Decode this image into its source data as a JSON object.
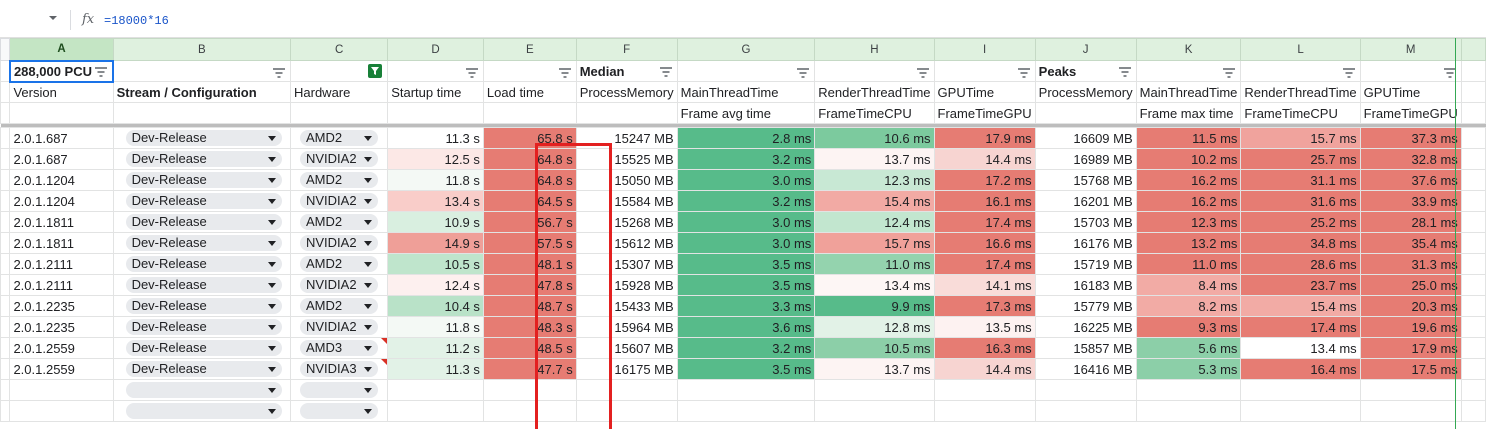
{
  "formula_bar": {
    "value": "=18000*16",
    "fx_label": "fx"
  },
  "columns": [
    {
      "letter": "A",
      "selected": true
    },
    {
      "letter": "B"
    },
    {
      "letter": "C"
    },
    {
      "letter": "D"
    },
    {
      "letter": "E"
    },
    {
      "letter": "F"
    },
    {
      "letter": "G"
    },
    {
      "letter": "H"
    },
    {
      "letter": "I"
    },
    {
      "letter": "J"
    },
    {
      "letter": "K"
    },
    {
      "letter": "L"
    },
    {
      "letter": "M"
    }
  ],
  "header_row1": [
    "288,000 PCU",
    "",
    "",
    "",
    "",
    "Median",
    "",
    "",
    "",
    "Peaks",
    "",
    "",
    ""
  ],
  "header_row2": [
    "Version",
    "Stream / Configuration",
    "Hardware",
    "Startup time",
    "Load time",
    "ProcessMemory",
    "MainThreadTime",
    "RenderThreadTime",
    "GPUTime",
    "ProcessMemory",
    "MainThreadTime",
    "RenderThreadTime",
    "GPUTime"
  ],
  "header_row3": [
    "",
    "",
    "",
    "",
    "",
    "",
    "Frame avg time",
    "FrameTimeCPU",
    "FrameTimeGPU",
    "",
    "Frame max time",
    "FrameTimeCPU",
    "FrameTimeGPU"
  ],
  "rows": [
    {
      "version": "2.0.1.687",
      "stream": "Dev-Release",
      "hardware": "AMD2",
      "startup": "11.3 s",
      "load": "65.8 s",
      "mem": "15247 MB",
      "main": "2.8 ms",
      "render": "10.6 ms",
      "gpu": "17.9 ms",
      "pmem": "16609 MB",
      "pmain": "11.5 ms",
      "prender": "15.7 ms",
      "pgpu": "37.3 ms"
    },
    {
      "version": "2.0.1.687",
      "stream": "Dev-Release",
      "hardware": "NVIDIA2",
      "startup": "12.5 s",
      "load": "64.8 s",
      "mem": "15525 MB",
      "main": "3.2 ms",
      "render": "13.7 ms",
      "gpu": "14.4 ms",
      "pmem": "16989 MB",
      "pmain": "10.2 ms",
      "prender": "25.7 ms",
      "pgpu": "32.8 ms"
    },
    {
      "version": "2.0.1.1204",
      "stream": "Dev-Release",
      "hardware": "AMD2",
      "startup": "11.8 s",
      "load": "64.8 s",
      "mem": "15050 MB",
      "main": "3.0 ms",
      "render": "12.3 ms",
      "gpu": "17.2 ms",
      "pmem": "15768 MB",
      "pmain": "16.2 ms",
      "prender": "31.1 ms",
      "pgpu": "37.6 ms"
    },
    {
      "version": "2.0.1.1204",
      "stream": "Dev-Release",
      "hardware": "NVIDIA2",
      "startup": "13.4 s",
      "load": "64.5 s",
      "mem": "15584 MB",
      "main": "3.2 ms",
      "render": "15.4 ms",
      "gpu": "16.1 ms",
      "pmem": "16201 MB",
      "pmain": "16.2 ms",
      "prender": "31.6 ms",
      "pgpu": "33.9 ms"
    },
    {
      "version": "2.0.1.1811",
      "stream": "Dev-Release",
      "hardware": "AMD2",
      "startup": "10.9 s",
      "load": "56.7 s",
      "mem": "15268 MB",
      "main": "3.0 ms",
      "render": "12.4 ms",
      "gpu": "17.4 ms",
      "pmem": "15703 MB",
      "pmain": "12.3 ms",
      "prender": "25.2 ms",
      "pgpu": "28.1 ms"
    },
    {
      "version": "2.0.1.1811",
      "stream": "Dev-Release",
      "hardware": "NVIDIA2",
      "startup": "14.9 s",
      "load": "57.5 s",
      "mem": "15612 MB",
      "main": "3.0 ms",
      "render": "15.7 ms",
      "gpu": "16.6 ms",
      "pmem": "16176 MB",
      "pmain": "13.2 ms",
      "prender": "34.8 ms",
      "pgpu": "35.4 ms"
    },
    {
      "version": "2.0.1.2111",
      "stream": "Dev-Release",
      "hardware": "AMD2",
      "startup": "10.5 s",
      "load": "48.1 s",
      "mem": "15307 MB",
      "main": "3.5 ms",
      "render": "11.0 ms",
      "gpu": "17.4 ms",
      "pmem": "15719 MB",
      "pmain": "11.0 ms",
      "prender": "28.6 ms",
      "pgpu": "31.3 ms"
    },
    {
      "version": "2.0.1.2111",
      "stream": "Dev-Release",
      "hardware": "NVIDIA2",
      "startup": "12.4 s",
      "load": "47.8 s",
      "mem": "15928 MB",
      "main": "3.5 ms",
      "render": "13.4 ms",
      "gpu": "14.1 ms",
      "pmem": "16183 MB",
      "pmain": "8.4 ms",
      "prender": "23.7 ms",
      "pgpu": "25.0 ms"
    },
    {
      "version": "2.0.1.2235",
      "stream": "Dev-Release",
      "hardware": "AMD2",
      "startup": "10.4 s",
      "load": "48.7 s",
      "mem": "15433 MB",
      "main": "3.3 ms",
      "render": "9.9 ms",
      "gpu": "17.3 ms",
      "pmem": "15779 MB",
      "pmain": "8.2 ms",
      "prender": "15.4 ms",
      "pgpu": "20.3 ms"
    },
    {
      "version": "2.0.1.2235",
      "stream": "Dev-Release",
      "hardware": "NVIDIA2",
      "startup": "11.8 s",
      "load": "48.3 s",
      "mem": "15964 MB",
      "main": "3.6 ms",
      "render": "12.8 ms",
      "gpu": "13.5 ms",
      "pmem": "16225 MB",
      "pmain": "9.3 ms",
      "prender": "17.4 ms",
      "pgpu": "19.6 ms"
    },
    {
      "version": "2.0.1.2559",
      "stream": "Dev-Release",
      "hardware": "AMD3",
      "startup": "11.2 s",
      "load": "48.5 s",
      "mem": "15607 MB",
      "main": "3.2 ms",
      "render": "10.5 ms",
      "gpu": "16.3 ms",
      "pmem": "15857 MB",
      "pmain": "5.6 ms",
      "prender": "13.4 ms",
      "pgpu": "17.9 ms"
    },
    {
      "version": "2.0.1.2559",
      "stream": "Dev-Release",
      "hardware": "NVIDIA3",
      "startup": "11.3 s",
      "load": "47.7 s",
      "mem": "16175 MB",
      "main": "3.5 ms",
      "render": "13.7 ms",
      "gpu": "14.4 ms",
      "pmem": "16416 MB",
      "pmain": "5.3 ms",
      "prender": "16.4 ms",
      "pgpu": "17.5 ms"
    }
  ],
  "colors": {
    "startup": [
      "#ffffff",
      "#fce8e6",
      "#f4f9f5",
      "#f9cdc9",
      "#d9efe0",
      "#ef9f98",
      "#bfe5cc",
      "#fdf0ef",
      "#b9e2c8",
      "#f4f9f5",
      "#e2f2e7",
      "#e2f2e7"
    ],
    "load": [
      "#e67c73",
      "#e67c73",
      "#e67c73",
      "#e67c73",
      "#e67c73",
      "#e67c73",
      "#e67c73",
      "#e67c73",
      "#e67c73",
      "#e67c73",
      "#e67c73",
      "#e67c73"
    ],
    "main": [
      "#57bb8a",
      "#57bb8a",
      "#57bb8a",
      "#57bb8a",
      "#57bb8a",
      "#57bb8a",
      "#57bb8a",
      "#57bb8a",
      "#57bb8a",
      "#57bb8a",
      "#57bb8a",
      "#57bb8a"
    ],
    "render": [
      "#7cca9e",
      "#fdf4f3",
      "#c8e8d4",
      "#f2aaa4",
      "#c2e6cf",
      "#f0a19a",
      "#94d3ae",
      "#fdf6f5",
      "#57bb8a",
      "#e2f2e7",
      "#8ccfa8",
      "#fdf4f3"
    ],
    "gpu": [
      "#e67c73",
      "#f7d4d1",
      "#e67c73",
      "#e67c73",
      "#e67c73",
      "#e67c73",
      "#e67c73",
      "#f9dcd9",
      "#e67c73",
      "#fdf2f1",
      "#e67c73",
      "#f7d4d1"
    ],
    "pmain": [
      "#e67c73",
      "#e67c73",
      "#e67c73",
      "#e67c73",
      "#e67c73",
      "#e67c73",
      "#e67c73",
      "#f2aba5",
      "#f2aba5",
      "#e67c73",
      "#8ccfa8",
      "#8ccfa8"
    ],
    "prender": [
      "#f0a39d",
      "#e67c73",
      "#e67c73",
      "#e67c73",
      "#e67c73",
      "#e67c73",
      "#e67c73",
      "#e67c73",
      "#f2aba5",
      "#e67c73",
      "#ffffff",
      "#e67c73"
    ],
    "pgpu": [
      "#e67c73",
      "#e67c73",
      "#e67c73",
      "#e67c73",
      "#e67c73",
      "#e67c73",
      "#e67c73",
      "#e67c73",
      "#e67c73",
      "#e67c73",
      "#e67c73",
      "#e67c73"
    ]
  },
  "empty_rows": 2
}
